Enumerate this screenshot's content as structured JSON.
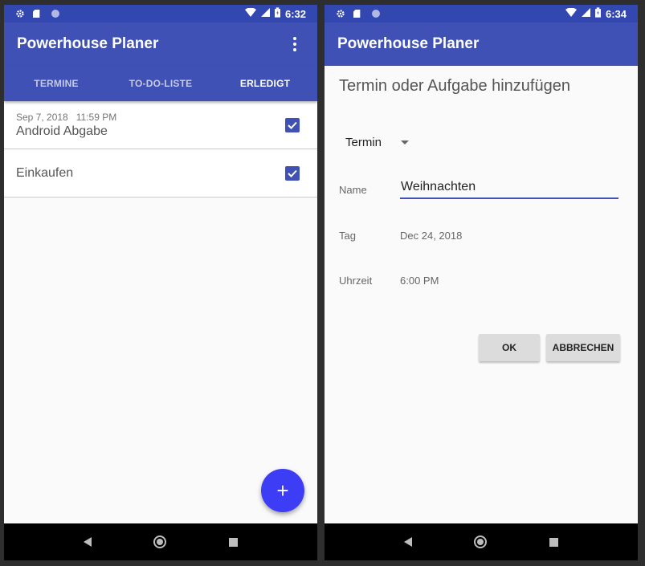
{
  "app": {
    "title": "Powerhouse Planer"
  },
  "left_phone": {
    "status_time": "6:32",
    "tabs": [
      {
        "label": "TERMINE",
        "active": false
      },
      {
        "label": "TO-DO-LISTE",
        "active": false
      },
      {
        "label": "ERLEDIGT",
        "active": true
      }
    ],
    "items": [
      {
        "meta": "Sep 7, 2018   11:59 PM",
        "name": "Android Abgabe",
        "checked": true
      },
      {
        "meta": "",
        "name": "Einkaufen",
        "checked": true
      }
    ],
    "fab_label": "+"
  },
  "right_phone": {
    "status_time": "6:34",
    "dialog": {
      "title": "Termin oder Aufgabe hinzufügen",
      "type_selected": "Termin",
      "name_label": "Name",
      "name_value": "Weihnachten",
      "tag_label": "Tag",
      "tag_value": "Dec 24, 2018",
      "time_label": "Uhrzeit",
      "time_value": "6:00 PM",
      "ok_label": "OK",
      "cancel_label": "ABBRECHEN"
    }
  },
  "colors": {
    "primary": "#3f51b5",
    "statusbar": "#3347b0",
    "fab": "#3d3df5",
    "background": "#fafafa"
  }
}
